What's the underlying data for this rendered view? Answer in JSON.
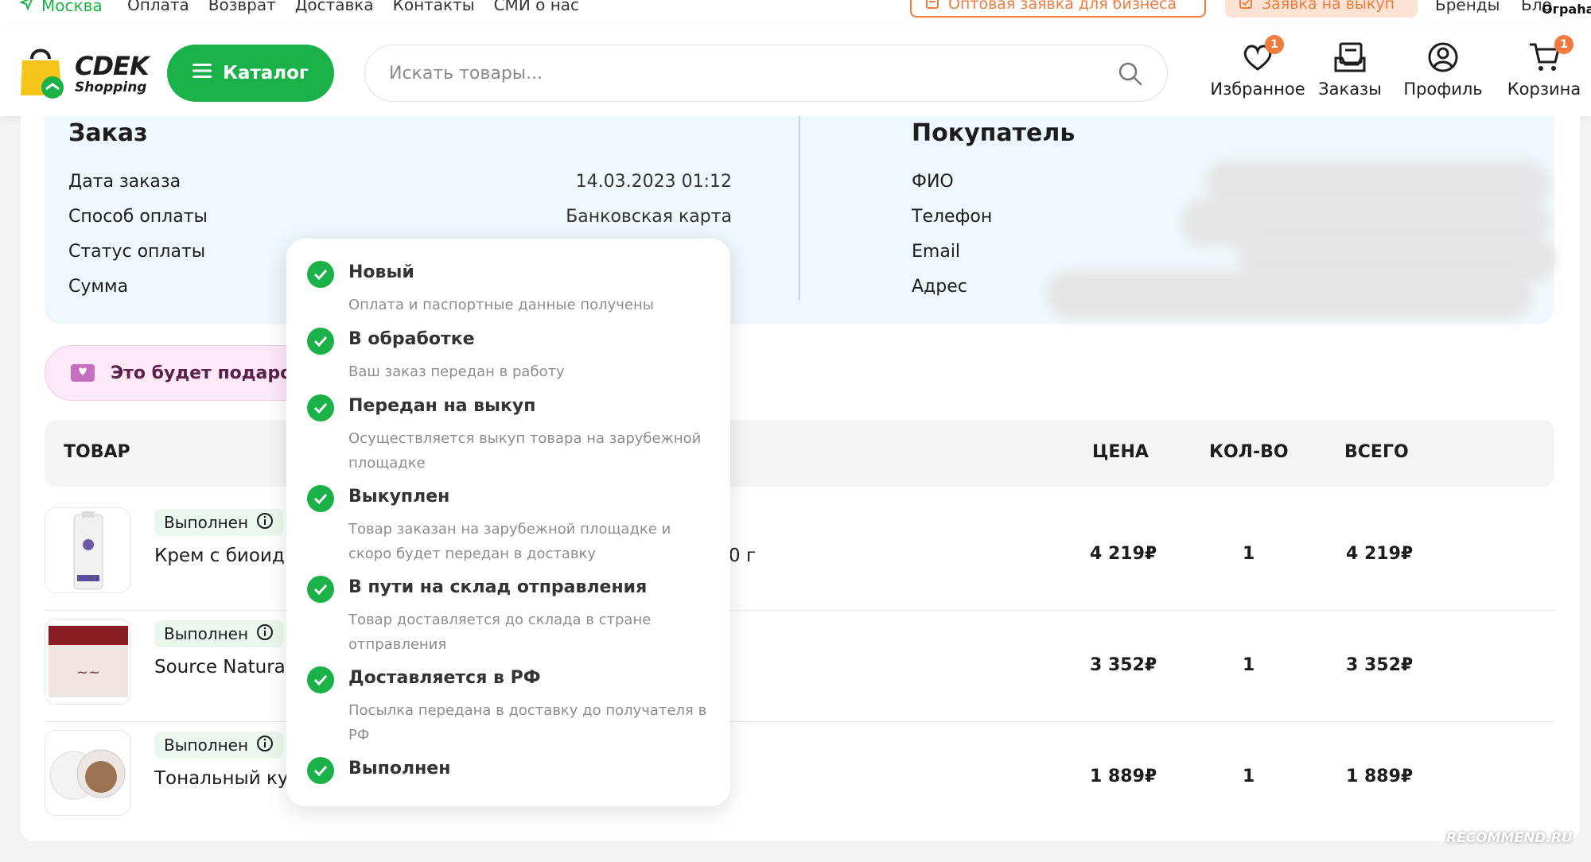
{
  "topbar": {
    "city": "Москва",
    "links": [
      "Оплата",
      "Возврат",
      "Доставка",
      "Контакты",
      "СМИ о нас"
    ],
    "wholesale": "Оптовая заявка для бизнеса",
    "buyout": "Заявка на выкуп",
    "brands": "Бренды",
    "blog": "Бло",
    "ograha": "Ограha"
  },
  "header": {
    "logo_brand": "CDEK",
    "logo_sub": "Shopping",
    "catalog_label": "Каталог",
    "search_placeholder": "Искать товары...",
    "favorites": {
      "label": "Избранное",
      "badge": "1"
    },
    "orders": {
      "label": "Заказы"
    },
    "profile": {
      "label": "Профиль"
    },
    "cart": {
      "label": "Корзина",
      "badge": "1"
    }
  },
  "order": {
    "title": "Заказ",
    "rows": [
      {
        "label": "Дата заказа",
        "value": "14.03.2023 01:12"
      },
      {
        "label": "Способ оплаты",
        "value": "Банковская карта"
      },
      {
        "label": "Статус оплаты",
        "value": ""
      },
      {
        "label": "Сумма",
        "value": ""
      }
    ]
  },
  "buyer": {
    "title": "Покупатель",
    "fields": [
      "ФИО",
      "Телефон",
      "Email",
      "Адрес"
    ]
  },
  "gift": {
    "label": "Это будет подарок"
  },
  "table": {
    "headers": {
      "product": "ТОВАР",
      "price": "ЦЕНА",
      "qty": "КОЛ-ВО",
      "total": "ВСЕГО"
    },
    "rows": [
      {
        "status": "Выполнен",
        "name": "Крем с биоид",
        "name_tail": "0 г",
        "price": "4 219₽",
        "qty": "1",
        "total": "4 219₽"
      },
      {
        "status": "Выполнен",
        "name": "Source Natural",
        "name_tail": "",
        "price": "3 352₽",
        "qty": "1",
        "total": "3 352₽"
      },
      {
        "status": "Выполнен",
        "name": "Тональный ку",
        "name_tail": "",
        "price": "1 889₽",
        "qty": "1",
        "total": "1 889₽"
      }
    ]
  },
  "timeline": [
    {
      "title": "Новый",
      "desc": "Оплата и паспортные данные получены"
    },
    {
      "title": "В обработке",
      "desc": "Ваш заказ передан в работу"
    },
    {
      "title": "Передан на выкуп",
      "desc": "Осуществляется выкуп товара на зарубежной площадке"
    },
    {
      "title": "Выкуплен",
      "desc": "Товар заказан на зарубежной площадке и скоро будет передан в доставку"
    },
    {
      "title": "В пути на склад отправления",
      "desc": "Товар доставляется до склада в стране отправления"
    },
    {
      "title": "Доставляется в РФ",
      "desc": "Посылка передана в доставку до получателя в РФ"
    },
    {
      "title": "Выполнен",
      "desc": ""
    }
  ],
  "watermark": "RECOMMEND.RU",
  "colors": {
    "green": "#1ab248",
    "orange": "#f07b3f",
    "info_bg": "#eef7fb"
  }
}
